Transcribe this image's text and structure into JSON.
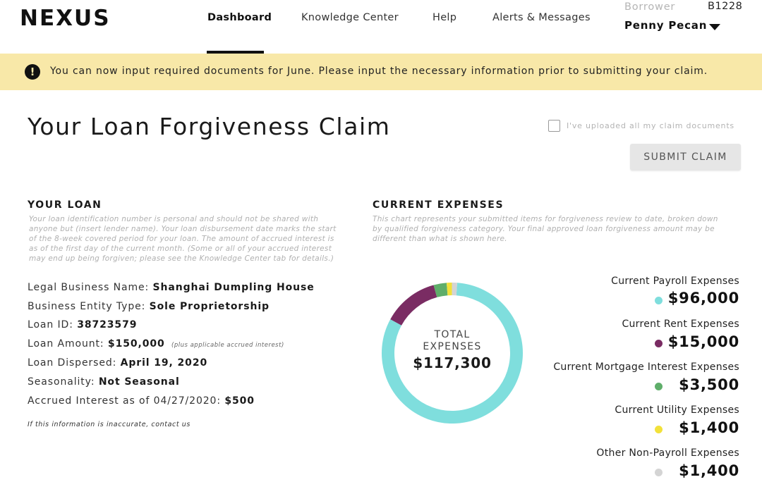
{
  "header": {
    "logo": "NEXUS",
    "nav": [
      "Dashboard",
      "Knowledge Center",
      "Help",
      "Alerts & Messages"
    ],
    "borrower_label": "Borrower",
    "borrower_id": "B1228",
    "borrower_name": "Penny Pecan"
  },
  "alert": {
    "text": "You can now input required documents for June. Please input the necessary information prior to submitting your claim."
  },
  "page": {
    "title": "Your Loan Forgiveness Claim",
    "upload_checkbox_label": "I've uploaded all my claim documents",
    "submit_label": "SUBMIT CLAIM"
  },
  "loan": {
    "title": "YOUR LOAN",
    "description_lines": [
      "Your loan identification number is personal and should not be shared with",
      "anyone but (insert lender name). Your loan disbursement date marks the start",
      "of the 8-week covered period for your loan. The amount of accrued interest is",
      "as of the first day of the current month. (Some or all of your accrued interest",
      "may end up being forgiven; please see the Knowledge Center tab for details.)"
    ],
    "fields": [
      {
        "label": "Legal Business Name:",
        "value": "Shanghai Dumpling House",
        "note": ""
      },
      {
        "label": "Business Entity Type:",
        "value": "Sole Proprietorship",
        "note": ""
      },
      {
        "label": "Loan ID:",
        "value": "38723579",
        "note": ""
      },
      {
        "label": "Loan Amount:",
        "value": "$150,000",
        "note": "(plus applicable accrued interest)"
      },
      {
        "label": "Loan Dispersed:",
        "value": "April 19, 2020",
        "note": ""
      },
      {
        "label": "Seasonality:",
        "value": "Not Seasonal",
        "note": ""
      },
      {
        "label": "Accrued Interest as of 04/27/2020:",
        "value": "$500",
        "note": ""
      }
    ],
    "footer": "If this information is inaccurate, contact us"
  },
  "expenses": {
    "title": "CURRENT EXPENSES",
    "description_lines": [
      "This chart represents your submitted items for forgiveness review to date, broken down",
      "by qualified forgiveness category. Your final approved loan forgiveness amount may be",
      "different than what is shown here."
    ],
    "total_label_line1": "TOTAL",
    "total_label_line2": "EXPENSES",
    "total_value": "$117,300",
    "items": [
      {
        "label": "Current Payroll Expenses",
        "value": "$96,000",
        "color": "#7fdedd"
      },
      {
        "label": "Current Rent Expenses",
        "value": "$15,000",
        "color": "#7a2c63"
      },
      {
        "label": "Current Mortgage Interest Expenses",
        "value": "$3,500",
        "color": "#5fae6a"
      },
      {
        "label": "Current Utility Expenses",
        "value": "$1,400",
        "color": "#f2e13a"
      },
      {
        "label": "Other Non-Payroll Expenses",
        "value": "$1,400",
        "color": "#d4d4d4"
      }
    ]
  },
  "chart_data": {
    "type": "pie",
    "categories": [
      "Current Payroll Expenses",
      "Current Rent Expenses",
      "Current Mortgage Interest Expenses",
      "Current Utility Expenses",
      "Other Non-Payroll Expenses"
    ],
    "values": [
      96000,
      15000,
      3500,
      1400,
      1400
    ],
    "colors": [
      "#7fdedd",
      "#7a2c63",
      "#5fae6a",
      "#f2e13a",
      "#d4d4d4"
    ],
    "style": "donut",
    "center_text": [
      "TOTAL",
      "EXPENSES",
      "$117,300"
    ]
  }
}
